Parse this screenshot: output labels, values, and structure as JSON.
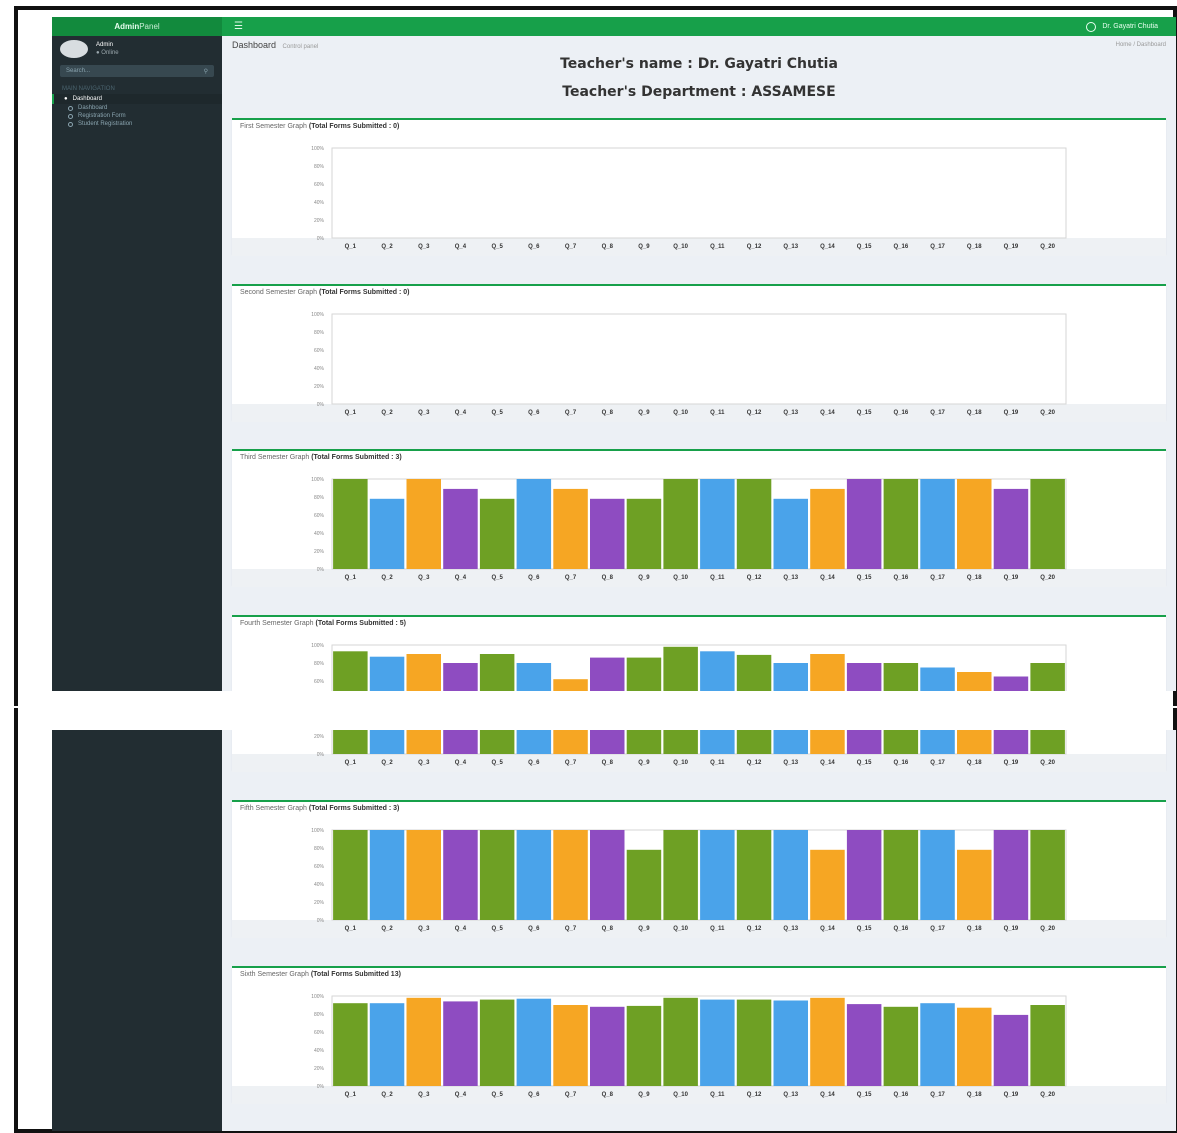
{
  "app": {
    "logo_bold": "Admin",
    "logo_light": "Panel",
    "user_menu": "Dr. Gayatri Chutia"
  },
  "sidebar": {
    "user_name": "Admin",
    "user_status": "● Online",
    "search_placeholder": "Search...",
    "header": "MAIN NAVIGATION",
    "active_item": "Dashboard",
    "items": [
      "Dashboard",
      "Registration Form",
      "Student Registration"
    ]
  },
  "page": {
    "title": "Dashboard",
    "subtitle": "Control panel",
    "breadcrumb": "Home / Dashboard",
    "teacher_name": "Teacher's name : Dr. Gayatri Chutia",
    "teacher_dept": "Teacher's Department : ASSAMESE"
  },
  "colors": {
    "green": "#6ea024",
    "blue": "#4aa3ea",
    "orange": "#f6a623",
    "purple": "#8e4cc1",
    "accent": "#17a04a"
  },
  "chart_data": [
    {
      "type": "bar",
      "title": "First Semester Graph",
      "subtitle": "(Total Forms Submitted : 0)",
      "categories": [
        "Q_1",
        "Q_2",
        "Q_3",
        "Q_4",
        "Q_5",
        "Q_6",
        "Q_7",
        "Q_8",
        "Q_9",
        "Q_10",
        "Q_11",
        "Q_12",
        "Q_13",
        "Q_14",
        "Q_15",
        "Q_16",
        "Q_17",
        "Q_18",
        "Q_19",
        "Q_20"
      ],
      "yticks": [
        "100%",
        "80%",
        "60%",
        "40%",
        "20%",
        "0%"
      ],
      "ylim": [
        0,
        100
      ],
      "values": [
        0,
        0,
        0,
        0,
        0,
        0,
        0,
        0,
        0,
        0,
        0,
        0,
        0,
        0,
        0,
        0,
        0,
        0,
        0,
        0
      ]
    },
    {
      "type": "bar",
      "title": "Second Semester Graph",
      "subtitle": "(Total Forms Submitted : 0)",
      "categories": [
        "Q_1",
        "Q_2",
        "Q_3",
        "Q_4",
        "Q_5",
        "Q_6",
        "Q_7",
        "Q_8",
        "Q_9",
        "Q_10",
        "Q_11",
        "Q_12",
        "Q_13",
        "Q_14",
        "Q_15",
        "Q_16",
        "Q_17",
        "Q_18",
        "Q_19",
        "Q_20"
      ],
      "yticks": [
        "100%",
        "80%",
        "60%",
        "40%",
        "20%",
        "0%"
      ],
      "ylim": [
        0,
        100
      ],
      "values": [
        0,
        0,
        0,
        0,
        0,
        0,
        0,
        0,
        0,
        0,
        0,
        0,
        0,
        0,
        0,
        0,
        0,
        0,
        0,
        0
      ]
    },
    {
      "type": "bar",
      "title": "Third Semester Graph",
      "subtitle": "(Total Forms Submitted : 3)",
      "categories": [
        "Q_1",
        "Q_2",
        "Q_3",
        "Q_4",
        "Q_5",
        "Q_6",
        "Q_7",
        "Q_8",
        "Q_9",
        "Q_10",
        "Q_11",
        "Q_12",
        "Q_13",
        "Q_14",
        "Q_15",
        "Q_16",
        "Q_17",
        "Q_18",
        "Q_19",
        "Q_20"
      ],
      "yticks": [
        "100%",
        "80%",
        "60%",
        "40%",
        "20%",
        "0%"
      ],
      "ylim": [
        0,
        100
      ],
      "values": [
        100,
        78,
        100,
        89,
        78,
        100,
        89,
        78,
        78,
        100,
        100,
        100,
        78,
        89,
        100,
        100,
        100,
        100,
        89,
        100
      ]
    },
    {
      "type": "bar",
      "title": "Fourth Semester Graph",
      "subtitle": "(Total Forms Submitted : 5)",
      "categories": [
        "Q_1",
        "Q_2",
        "Q_3",
        "Q_4",
        "Q_5",
        "Q_6",
        "Q_7",
        "Q_8",
        "Q_9",
        "Q_10",
        "Q_11",
        "Q_12",
        "Q_13",
        "Q_14",
        "Q_15",
        "Q_16",
        "Q_17",
        "Q_18",
        "Q_19",
        "Q_20"
      ],
      "yticks": [
        "100%",
        "80%",
        "60%",
        "40%",
        "20%",
        "0%"
      ],
      "ylim": [
        0,
        100
      ],
      "values": [
        93,
        87,
        90,
        80,
        90,
        80,
        62,
        86,
        86,
        98,
        93,
        89,
        80,
        90,
        80,
        80,
        75,
        70,
        65,
        80
      ]
    },
    {
      "type": "bar",
      "title": "Fifth Semester Graph",
      "subtitle": "(Total Forms Submitted : 3)",
      "categories": [
        "Q_1",
        "Q_2",
        "Q_3",
        "Q_4",
        "Q_5",
        "Q_6",
        "Q_7",
        "Q_8",
        "Q_9",
        "Q_10",
        "Q_11",
        "Q_12",
        "Q_13",
        "Q_14",
        "Q_15",
        "Q_16",
        "Q_17",
        "Q_18",
        "Q_19",
        "Q_20"
      ],
      "yticks": [
        "100%",
        "80%",
        "60%",
        "40%",
        "20%",
        "0%"
      ],
      "ylim": [
        0,
        100
      ],
      "values": [
        100,
        100,
        100,
        100,
        100,
        100,
        100,
        100,
        78,
        100,
        100,
        100,
        100,
        78,
        100,
        100,
        100,
        78,
        100,
        100
      ]
    },
    {
      "type": "bar",
      "title": "Sixth Semester Graph",
      "subtitle": "(Total Forms Submitted 13)",
      "categories": [
        "Q_1",
        "Q_2",
        "Q_3",
        "Q_4",
        "Q_5",
        "Q_6",
        "Q_7",
        "Q_8",
        "Q_9",
        "Q_10",
        "Q_11",
        "Q_12",
        "Q_13",
        "Q_14",
        "Q_15",
        "Q_16",
        "Q_17",
        "Q_18",
        "Q_19",
        "Q_20"
      ],
      "yticks": [
        "100%",
        "80%",
        "60%",
        "40%",
        "20%",
        "0%"
      ],
      "ylim": [
        0,
        100
      ],
      "values": [
        92,
        92,
        98,
        94,
        96,
        97,
        90,
        88,
        89,
        98,
        96,
        96,
        95,
        98,
        91,
        88,
        92,
        87,
        79,
        90
      ]
    }
  ]
}
